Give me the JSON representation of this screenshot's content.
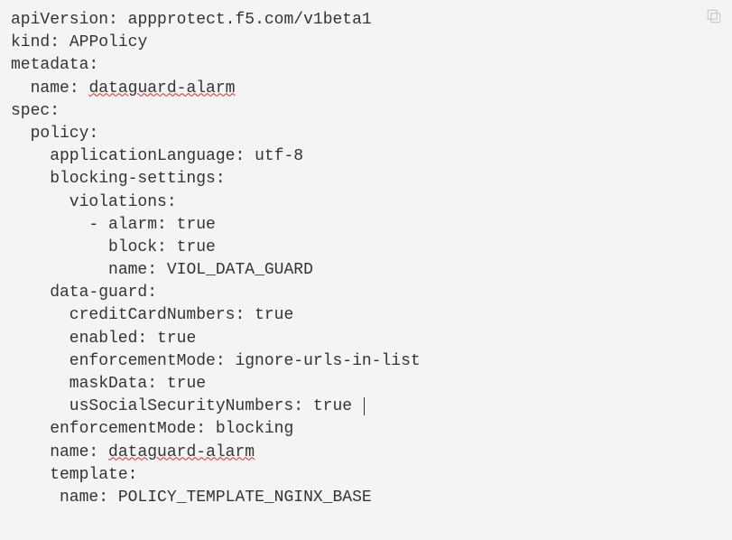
{
  "code": {
    "l1_key": "apiVersion",
    "l1_val": "appprotect.f5.com/v1beta1",
    "l2_key": "kind",
    "l2_val": "APPolicy",
    "l3_key": "metadata",
    "l4_key": "name",
    "l4_val": "dataguard-alarm",
    "l5_key": "spec",
    "l6_key": "policy",
    "l7_key": "applicationLanguage",
    "l7_val": "utf-8",
    "l8_key": "blocking-settings",
    "l9_key": "violations",
    "l10_bullet": "- ",
    "l10_key": "alarm",
    "l10_val": "true",
    "l11_key": "block",
    "l11_val": "true",
    "l12_key": "name",
    "l12_val": "VIOL_DATA_GUARD",
    "l13_key": "data-guard",
    "l14_key": "creditCardNumbers",
    "l14_val": "true",
    "l15_key": "enabled",
    "l15_val": "true",
    "l16_key": "enforcementMode",
    "l16_val": "ignore-urls-in-list",
    "l17_key": "maskData",
    "l17_val": "true",
    "l18_key": "usSocialSecurityNumbers",
    "l18_val": "true",
    "l19_key": "enforcementMode",
    "l19_val": "blocking",
    "l20_key": "name",
    "l20_val": "dataguard-alarm",
    "l21_key": "template",
    "l22_key": "name",
    "l22_val": "POLICY_TEMPLATE_NGINX_BASE"
  },
  "colon": ":",
  "space": " "
}
